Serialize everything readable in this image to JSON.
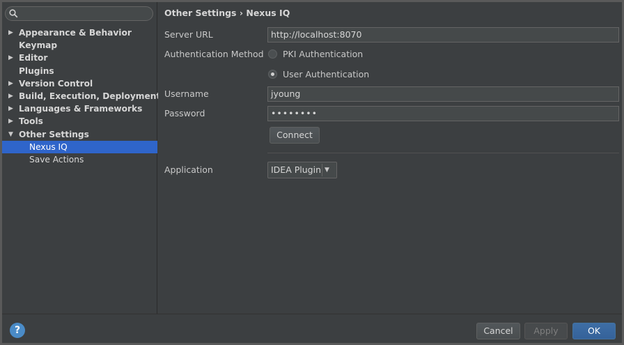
{
  "sidebar": {
    "search": {
      "placeholder": "",
      "value": ""
    },
    "items": [
      {
        "label": "Appearance & Behavior",
        "arrow": "▶"
      },
      {
        "label": "Keymap",
        "arrow": ""
      },
      {
        "label": "Editor",
        "arrow": "▶"
      },
      {
        "label": "Plugins",
        "arrow": ""
      },
      {
        "label": "Version Control",
        "arrow": "▶"
      },
      {
        "label": "Build, Execution, Deployment",
        "arrow": "▶"
      },
      {
        "label": "Languages & Frameworks",
        "arrow": "▶"
      },
      {
        "label": "Tools",
        "arrow": "▶"
      },
      {
        "label": "Other Settings",
        "arrow": "▼"
      },
      {
        "label": "Nexus IQ",
        "arrow": "",
        "selected": true
      },
      {
        "label": "Save Actions",
        "arrow": ""
      }
    ]
  },
  "header": {
    "breadcrumb": "Other Settings › Nexus IQ"
  },
  "form": {
    "server_url_label": "Server URL",
    "server_url_value": "http://localhost:8070",
    "auth_method_label": "Authentication Method",
    "auth_options": [
      {
        "label": "PKI Authentication",
        "selected": false
      },
      {
        "label": "User Authentication",
        "selected": true
      }
    ],
    "username_label": "Username",
    "username_value": "jyoung",
    "password_label": "Password",
    "password_value": "••••••••",
    "connect_label": "Connect",
    "application_label": "Application",
    "application_value": "IDEA Plugin",
    "application_arrow": "▼"
  },
  "footer": {
    "help_label": "?",
    "cancel_label": "Cancel",
    "apply_label": "Apply",
    "ok_label": "OK"
  },
  "colors": {
    "selection": "#2f65ca",
    "panel": "#3c3f41",
    "ok_button": "#365880",
    "help_icon": "#4a8bc7"
  }
}
